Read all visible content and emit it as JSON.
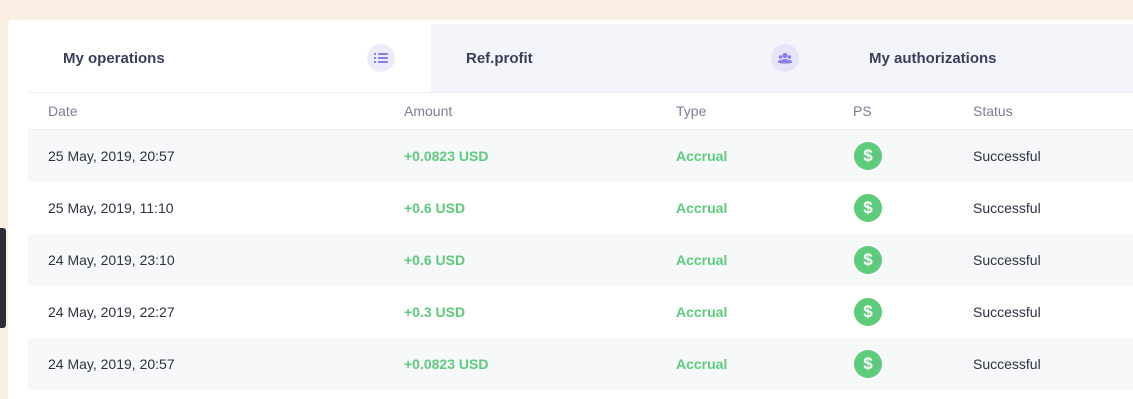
{
  "tabs": [
    {
      "label": "My operations",
      "icon": "list-icon"
    },
    {
      "label": "Ref.profit",
      "icon": "users-icon"
    },
    {
      "label": "My authorizations"
    }
  ],
  "table": {
    "headers": {
      "date": "Date",
      "amount": "Amount",
      "type": "Type",
      "ps": "PS",
      "status": "Status"
    },
    "rows": [
      {
        "date": "25 May, 2019, 20:57",
        "amount": "+0.0823 USD",
        "type": "Accrual",
        "ps_symbol": "$",
        "status": "Successful"
      },
      {
        "date": "25 May, 2019, 11:10",
        "amount": "+0.6 USD",
        "type": "Accrual",
        "ps_symbol": "$",
        "status": "Successful"
      },
      {
        "date": "24 May, 2019, 23:10",
        "amount": "+0.6 USD",
        "type": "Accrual",
        "ps_symbol": "$",
        "status": "Successful"
      },
      {
        "date": "24 May, 2019, 22:27",
        "amount": "+0.3 USD",
        "type": "Accrual",
        "ps_symbol": "$",
        "status": "Successful"
      },
      {
        "date": "24 May, 2019, 20:57",
        "amount": "+0.0823 USD",
        "type": "Accrual",
        "ps_symbol": "$",
        "status": "Successful"
      }
    ]
  },
  "colors": {
    "background": "#f9efe3",
    "accent_green": "#5ccb7c",
    "accent_purple": "#8a7de8",
    "text_dark": "#3a3f5c"
  }
}
